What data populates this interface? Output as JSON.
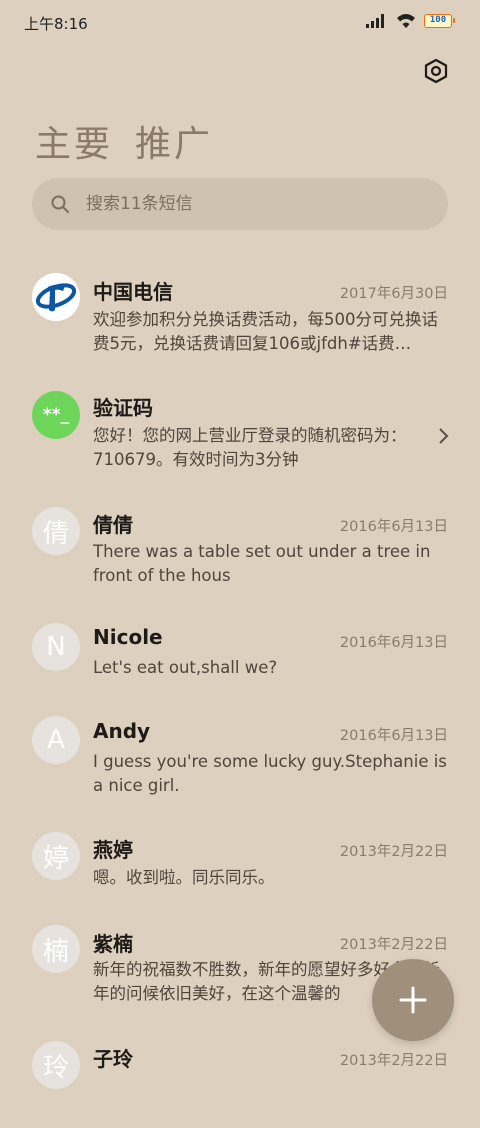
{
  "status_bar": {
    "time": "上午8:16",
    "battery": "100"
  },
  "tabs": [
    {
      "label": "主要"
    },
    {
      "label": "推广"
    }
  ],
  "search": {
    "placeholder": "搜索11条短信"
  },
  "conversations": [
    {
      "name": "中国电信",
      "date": "2017年6月30日",
      "preview": "欢迎参加积分兑换话费活动，每500分可兑换话费5元，兑换话费请回复106或jfdh#话费…",
      "avatar": "telecom-logo"
    },
    {
      "name": "验证码",
      "date": "",
      "preview": "您好！您的网上营业厅登录的随机密码为：710679。有效时间为3分钟",
      "avatar_text": "**_",
      "avatar_color": "#6dd55a"
    },
    {
      "name": "倩倩",
      "date": "2016年6月13日",
      "preview": "There was a table set out under a tree in front of the hous",
      "avatar_text": "倩"
    },
    {
      "name": "Nicole",
      "date": "2016年6月13日",
      "preview": "Let's eat out,shall we?",
      "avatar_text": "N"
    },
    {
      "name": "Andy",
      "date": "2016年6月13日",
      "preview": "I guess you're some lucky guy.Stephanie is a nice girl.",
      "avatar_text": "A"
    },
    {
      "name": "燕婷",
      "date": "2013年2月22日",
      "preview": "嗯。收到啦。同乐同乐。",
      "avatar_text": "婷"
    },
    {
      "name": "紫楠",
      "date": "2013年2月22日",
      "preview": "新年的祝福数不胜数，新年的愿望好多好多，新年的问候依旧美好，在这个温馨的",
      "avatar_text": "楠"
    },
    {
      "name": "子玲",
      "date": "2013年2月22日",
      "preview": "",
      "avatar_text": "玲"
    }
  ],
  "colors": {
    "background": "#ddd0bf",
    "accent": "#a08f7a",
    "verify_green": "#6dd55a",
    "telecom_blue": "#0b57a4"
  },
  "icons": {
    "settings": "settings-hexagon-icon",
    "search": "search-icon",
    "fab": "plus-icon",
    "chevron": "chevron-right-icon"
  }
}
